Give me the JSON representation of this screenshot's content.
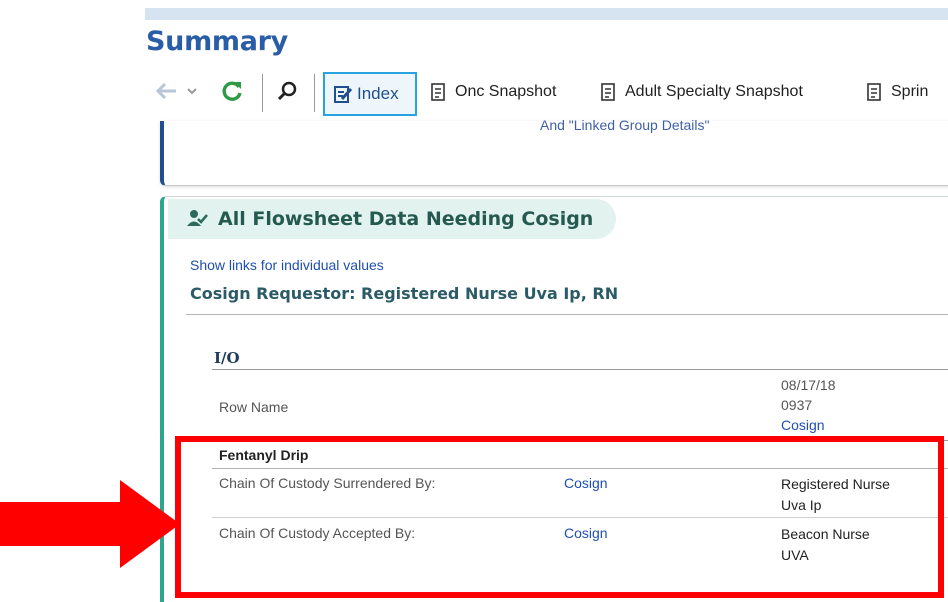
{
  "title": "Summary",
  "toolbar": {
    "back_icon": "back-arrow-icon",
    "refresh_icon": "refresh-icon",
    "search_icon": "search-icon",
    "tabs": [
      {
        "label": "Index",
        "icon": "index-icon"
      },
      {
        "label": "Onc Snapshot",
        "icon": "report-icon"
      },
      {
        "label": "Adult Specialty Snapshot",
        "icon": "report-icon"
      },
      {
        "label": "Sprin",
        "icon": "report-icon"
      }
    ]
  },
  "card1": {
    "link_text": "And \"Linked Group Details\""
  },
  "flowsheet": {
    "header": "All Flowsheet Data Needing Cosign",
    "show_links": "Show links for individual values",
    "requestor": "Cosign Requestor: Registered Nurse Uva Ip, RN",
    "group": "I/O",
    "row_name_header": "Row Name",
    "date": "08/17/18",
    "time": "0937",
    "cosign_header_link": "Cosign",
    "section": "Fentanyl Drip",
    "rows": [
      {
        "label": "Chain Of Custody Surrendered By:",
        "link": "Cosign",
        "value": "Registered Nurse Uva Ip"
      },
      {
        "label": "Chain Of Custody Accepted By:",
        "link": "Cosign",
        "value": "Beacon Nurse UVA"
      }
    ]
  },
  "colors": {
    "title": "#2a5da8",
    "highlight": "#ff0000",
    "accent_teal": "#2ea58d"
  }
}
